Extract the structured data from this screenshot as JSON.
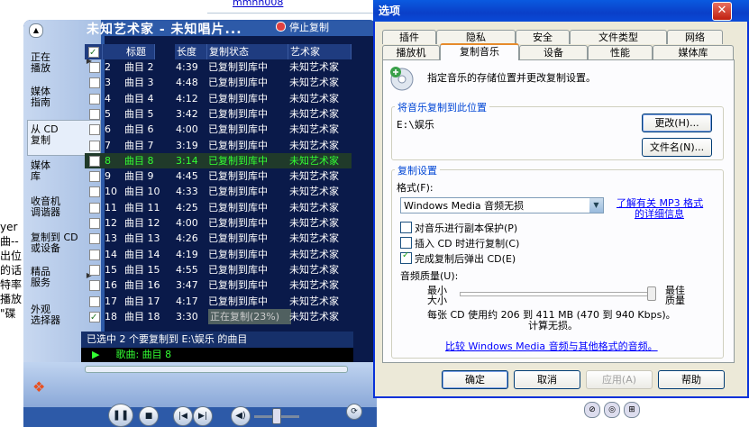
{
  "background": {
    "link": "mmhh008",
    "fragments": [
      "yer",
      "曲--",
      "出位",
      "的话",
      "特率",
      "播放",
      "\"碟"
    ]
  },
  "wmp": {
    "now_title": "未知艺术家 - 未知唱片...",
    "stop_copy": "停止复制",
    "sidebar": [
      {
        "label": "正在\n播放",
        "arrow": true
      },
      {
        "label": "媒体\n指南",
        "arrow": false
      },
      {
        "label": "从 CD\n复制",
        "arrow": false
      },
      {
        "label": "媒体\n库",
        "arrow": false
      },
      {
        "label": "收音机\n调谐器",
        "arrow": false
      },
      {
        "label": "复制到 CD\n或设备",
        "arrow": false
      },
      {
        "label": "精品\n服务",
        "arrow": true
      },
      {
        "label": "外观\n选择器",
        "arrow": false
      }
    ],
    "columns": [
      "标题",
      "长度",
      "复制状态",
      "艺术家"
    ],
    "rows": [
      {
        "num": "2",
        "title": "曲目 2",
        "len": "4:39",
        "status": "已复制到库中",
        "artist": "未知艺术家",
        "checked": false,
        "hl": false
      },
      {
        "num": "3",
        "title": "曲目 3",
        "len": "4:48",
        "status": "已复制到库中",
        "artist": "未知艺术家",
        "checked": false,
        "hl": false
      },
      {
        "num": "4",
        "title": "曲目 4",
        "len": "4:12",
        "status": "已复制到库中",
        "artist": "未知艺术家",
        "checked": false,
        "hl": false
      },
      {
        "num": "5",
        "title": "曲目 5",
        "len": "3:42",
        "status": "已复制到库中",
        "artist": "未知艺术家",
        "checked": false,
        "hl": false
      },
      {
        "num": "6",
        "title": "曲目 6",
        "len": "4:00",
        "status": "已复制到库中",
        "artist": "未知艺术家",
        "checked": false,
        "hl": false
      },
      {
        "num": "7",
        "title": "曲目 7",
        "len": "3:19",
        "status": "已复制到库中",
        "artist": "未知艺术家",
        "checked": false,
        "hl": false
      },
      {
        "num": "8",
        "title": "曲目 8",
        "len": "3:14",
        "status": "已复制到库中",
        "artist": "未知艺术家",
        "checked": false,
        "hl": true
      },
      {
        "num": "9",
        "title": "曲目 9",
        "len": "4:45",
        "status": "已复制到库中",
        "artist": "未知艺术家",
        "checked": false,
        "hl": false
      },
      {
        "num": "10",
        "title": "曲目 10",
        "len": "4:33",
        "status": "已复制到库中",
        "artist": "未知艺术家",
        "checked": false,
        "hl": false
      },
      {
        "num": "11",
        "title": "曲目 11",
        "len": "4:25",
        "status": "已复制到库中",
        "artist": "未知艺术家",
        "checked": false,
        "hl": false
      },
      {
        "num": "12",
        "title": "曲目 12",
        "len": "4:00",
        "status": "已复制到库中",
        "artist": "未知艺术家",
        "checked": false,
        "hl": false
      },
      {
        "num": "13",
        "title": "曲目 13",
        "len": "4:26",
        "status": "已复制到库中",
        "artist": "未知艺术家",
        "checked": false,
        "hl": false
      },
      {
        "num": "14",
        "title": "曲目 14",
        "len": "4:19",
        "status": "已复制到库中",
        "artist": "未知艺术家",
        "checked": false,
        "hl": false
      },
      {
        "num": "15",
        "title": "曲目 15",
        "len": "4:55",
        "status": "已复制到库中",
        "artist": "未知艺术家",
        "checked": false,
        "hl": false
      },
      {
        "num": "16",
        "title": "曲目 16",
        "len": "3:47",
        "status": "已复制到库中",
        "artist": "未知艺术家",
        "checked": false,
        "hl": false
      },
      {
        "num": "17",
        "title": "曲目 17",
        "len": "4:17",
        "status": "已复制到库中",
        "artist": "未知艺术家",
        "checked": false,
        "hl": false
      },
      {
        "num": "18",
        "title": "曲目 18",
        "len": "3:30",
        "status": "正在复制(23%)",
        "artist": "未知艺术家",
        "checked": true,
        "hl": false,
        "progress": true
      }
    ],
    "status_text": "已选中 2 个要复制到 E:\\娱乐 的曲目",
    "now_playing": "歌曲: 曲目 8"
  },
  "dialog": {
    "title": "选项",
    "tabs_row1": [
      "插件",
      "隐私",
      "安全",
      "文件类型",
      "网络"
    ],
    "tabs_row2": [
      "播放机",
      "复制音乐",
      "设备",
      "性能",
      "媒体库"
    ],
    "selected_tab": "复制音乐",
    "description": "指定音乐的存储位置并更改复制设置。",
    "location_group": "将音乐复制到此位置",
    "location_path": "E:\\娱乐",
    "change_btn": "更改(H)...",
    "filename_btn": "文件名(N)...",
    "settings_group": "复制设置",
    "format_label": "格式(F):",
    "format_value": "Windows Media 音频无损",
    "learn_more_1": "了解有关 MP3 格式",
    "learn_more_2": "的详细信息",
    "cb_protect": "对音乐进行副本保护(P)",
    "cb_protect_checked": false,
    "cb_insert": "插入 CD 时进行复制(C)",
    "cb_insert_checked": false,
    "cb_eject": "完成复制后弹出 CD(E)",
    "cb_eject_checked": true,
    "quality_label": "音频质量(U):",
    "q_min_1": "最小",
    "q_min_2": "大小",
    "q_max_1": "最佳",
    "q_max_2": "质量",
    "quality_desc_1": "每张 CD 使用约 206 到 411 MB (470 到 940 Kbps)。",
    "quality_desc_2": "计算无损。",
    "compare_link": "比较 Windows Media 音频与其他格式的音频。",
    "ok": "确定",
    "cancel": "取消",
    "apply": "应用(A)",
    "help": "帮助"
  }
}
